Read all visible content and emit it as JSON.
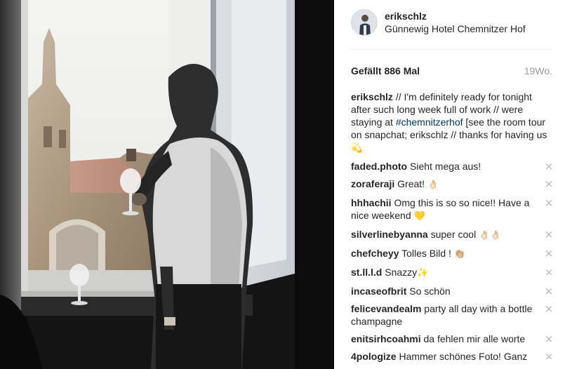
{
  "photo": {
    "icon": "post-photo"
  },
  "post": {
    "username": "erikschlz",
    "location": "Günnewig Hotel Chemnitzer Hof",
    "likes": "Gefällt 886 Mal",
    "age": "19Wo."
  },
  "caption": {
    "author": "erikschlz",
    "text_before": " // I'm definitely ready for tonight after such long week full of work // were staying at ",
    "hashtag": "#chemnitzerhof",
    "text_after": " [see the room tour on snapchat; erikschlz // thanks for having us ",
    "emoji": "💫"
  },
  "comments": [
    {
      "author": "faded.photo",
      "text": " Sieht mega aus!",
      "emoji": ""
    },
    {
      "author": "zoraferaji",
      "text": " Great! ",
      "emoji": "👌🏻"
    },
    {
      "author": "hhhachii",
      "text": " Omg this is so so nice!! Have a nice weekend ",
      "emoji": "💛"
    },
    {
      "author": "silverlinebyanna",
      "text": " super cool ",
      "emoji": "👌🏻👌🏻"
    },
    {
      "author": "chefcheyy",
      "text": " Tolles Bild ! ",
      "emoji": "👏🏼"
    },
    {
      "author": "st.ll.l.d",
      "text": " Snazzy",
      "emoji": "✨"
    },
    {
      "author": "incaseofbrit",
      "text": " So schön",
      "emoji": ""
    },
    {
      "author": "felicevandealm",
      "text": " party all day with a bottle champagne",
      "emoji": ""
    },
    {
      "author": "enitsirhcoahmi",
      "text": " da fehlen mir alle worte",
      "emoji": ""
    },
    {
      "author": "4pologize",
      "text": " Hammer schönes Foto! Ganz",
      "emoji": ""
    }
  ],
  "delete_icon": "×"
}
